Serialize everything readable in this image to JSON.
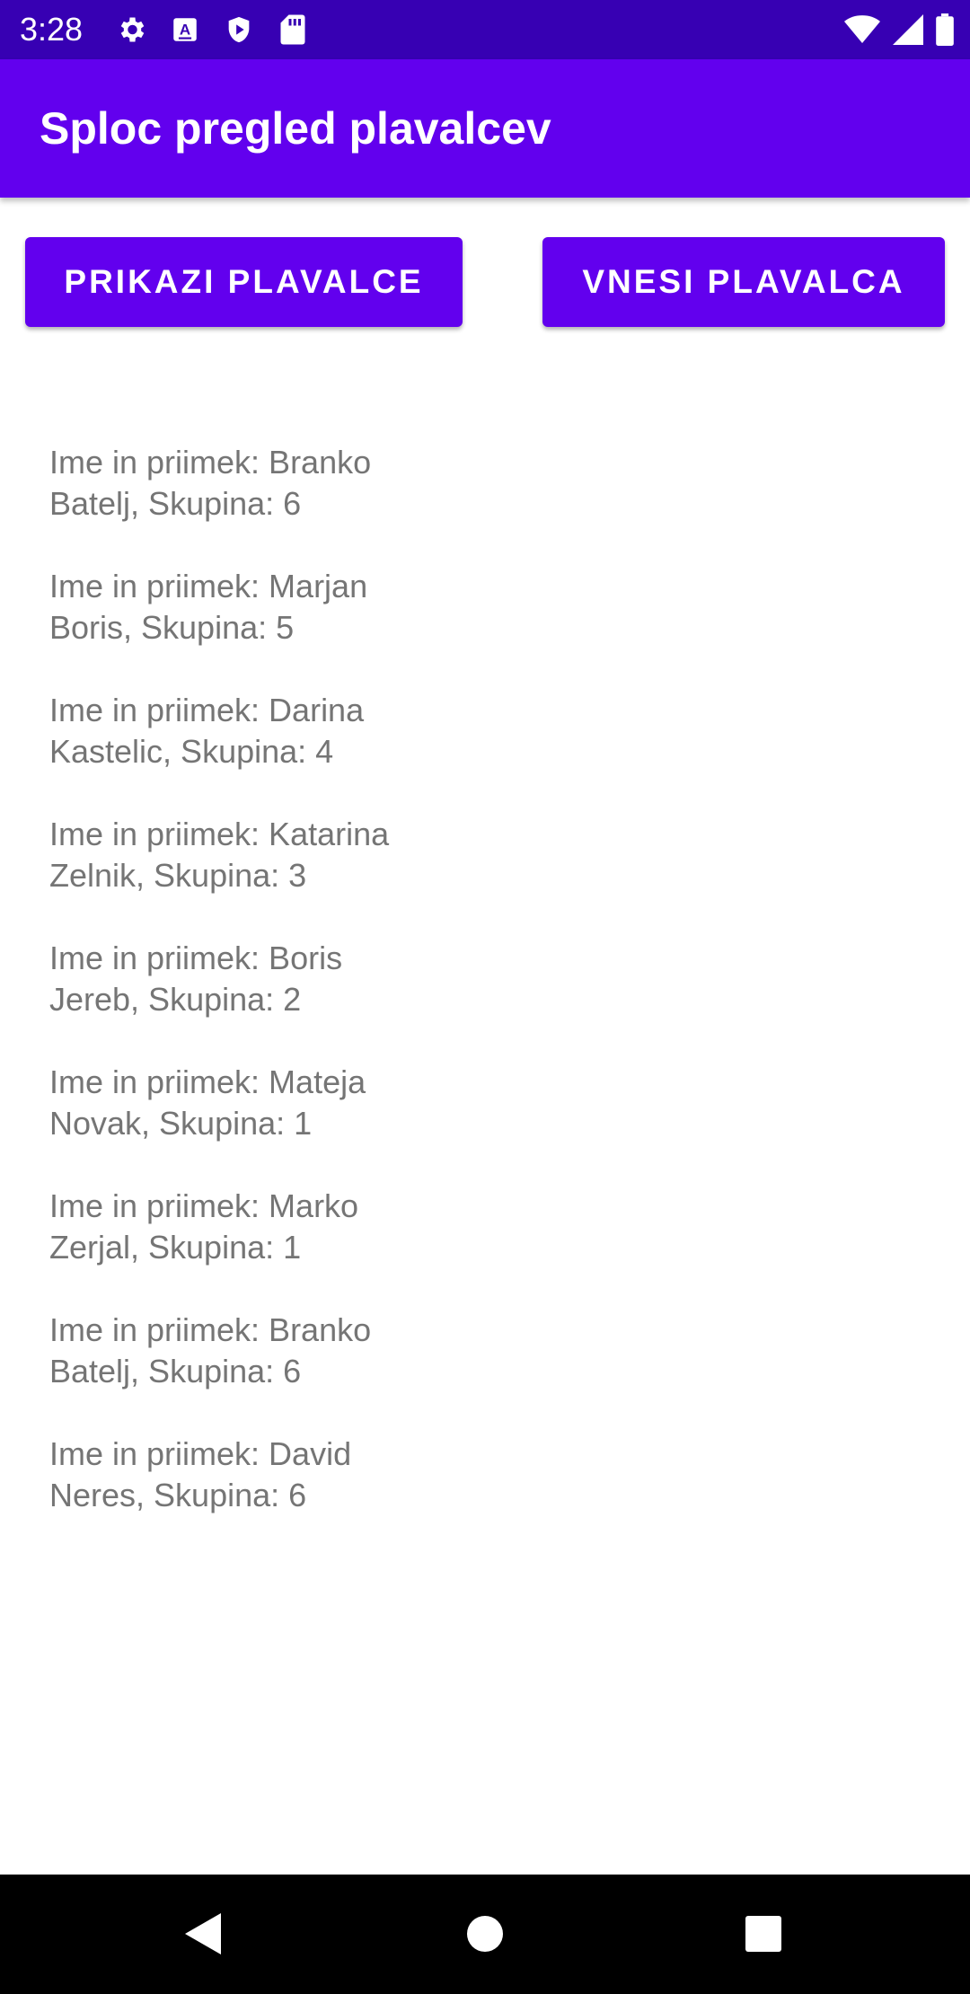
{
  "status_bar": {
    "time": "3:28",
    "left_icons": [
      "settings-icon",
      "keyboard-a-icon",
      "play-protect-icon",
      "sd-card-icon"
    ],
    "right_icons": [
      "wifi-icon",
      "cell-signal-icon",
      "battery-icon"
    ],
    "background": "#3700b3"
  },
  "app_bar": {
    "title": "Sploc pregled plavalcev",
    "background": "#6200ee"
  },
  "buttons": {
    "show_label": "PRIKAZI PLAVALCE",
    "add_label": "VNESI PLAVALCA"
  },
  "swimmers": [
    {
      "line1": "Ime in priimek: Branko",
      "line2": "Batelj, Skupina: 6"
    },
    {
      "line1": "Ime in priimek: Marjan",
      "line2": "Boris, Skupina: 5"
    },
    {
      "line1": "Ime in priimek: Darina",
      "line2": "Kastelic, Skupina: 4"
    },
    {
      "line1": "Ime in priimek: Katarina",
      "line2": "Zelnik, Skupina: 3"
    },
    {
      "line1": "Ime in priimek: Boris",
      "line2": "Jereb, Skupina: 2"
    },
    {
      "line1": "Ime in priimek: Mateja",
      "line2": "Novak, Skupina: 1"
    },
    {
      "line1": "Ime in priimek: Marko",
      "line2": "Zerjal, Skupina: 1"
    },
    {
      "line1": "Ime in priimek: Branko",
      "line2": "Batelj, Skupina: 6"
    },
    {
      "line1": "Ime in priimek: David",
      "line2": "Neres, Skupina: 6"
    }
  ],
  "nav_bar": {
    "icons": [
      "back-icon",
      "home-icon",
      "recents-icon"
    ]
  }
}
